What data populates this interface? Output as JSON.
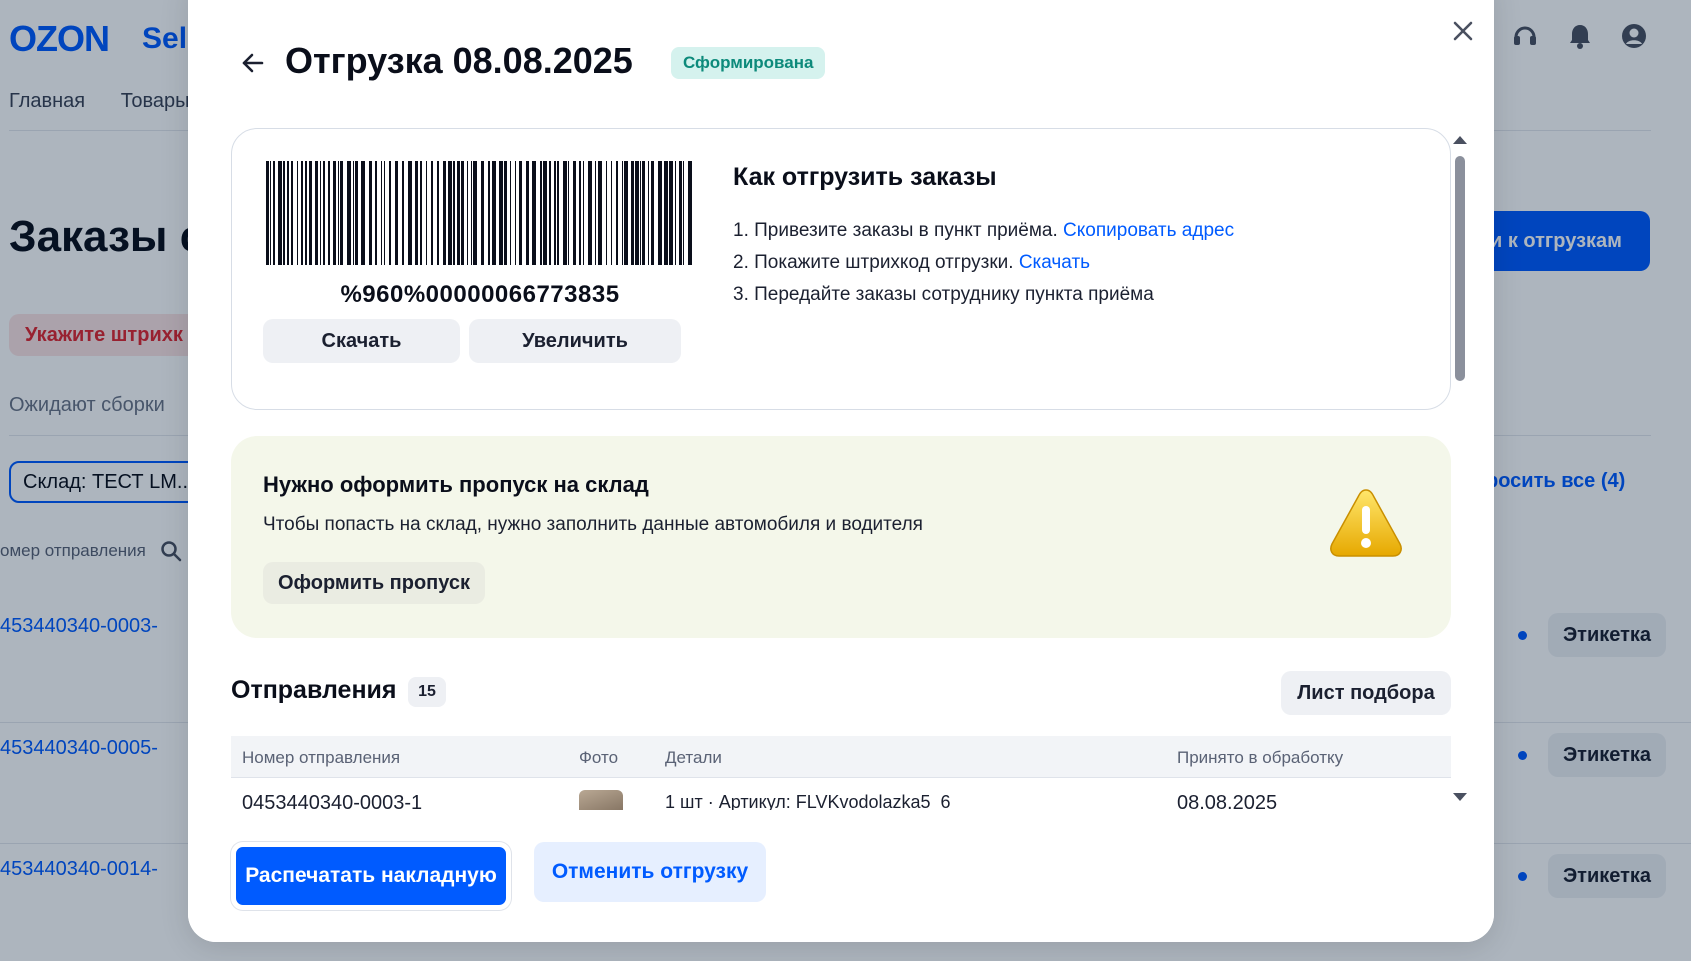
{
  "app": {
    "logo": "OZON",
    "logo_suffix": "Seller",
    "nav": [
      "Главная",
      "Товары"
    ]
  },
  "background": {
    "page_title": "Заказы c",
    "primary_button": "и к отгрузкам",
    "alert": "Укажите штрихк",
    "waiting_label": "Ожидают сборки",
    "warehouse_select": "Склад: ТЕСТ LM...",
    "reset_all": "росить все (4)",
    "column_label": "омер отправления",
    "orders": [
      {
        "number": "453440340-0003-",
        "label_button": "Этикетка"
      },
      {
        "number": "453440340-0005-",
        "label_button": "Этикетка"
      },
      {
        "number": "453440340-0014-",
        "label_button": "Этикетка"
      }
    ]
  },
  "modal": {
    "title": "Отгрузка 08.08.2025",
    "status": "Сформирована",
    "barcode": {
      "value": "%960%00000066773835",
      "download_label": "Скачать",
      "zoom_label": "Увеличить"
    },
    "how_to": {
      "title": "Как отгрузить заказы",
      "steps": [
        {
          "text": "1. Привезите заказы в пункт приёма.",
          "link": "Скопировать адрес"
        },
        {
          "text": "2. Покажите штрихкод отгрузки.",
          "link": "Скачать"
        },
        {
          "text": "3. Передайте заказы сотруднику пункта приёма",
          "link": ""
        }
      ]
    },
    "pass": {
      "title": "Нужно оформить пропуск на склад",
      "text": "Чтобы попасть на склад, нужно заполнить данные автомобиля и водителя",
      "button": "Оформить пропуск",
      "icon": "warning-icon"
    },
    "shipments": {
      "title": "Отправления",
      "count": "15",
      "pick_list_button": "Лист подбора",
      "columns": [
        "Номер отправления",
        "Фото",
        "Детали",
        "Принято в обработку"
      ],
      "rows": [
        {
          "number": "0453440340-0003-1",
          "details": "1 шт · Артикул: FLVKvodolazka5_6",
          "accepted": "08.08.2025"
        }
      ]
    },
    "footer": {
      "print_button": "Распечатать накладную",
      "cancel_button": "Отменить отгрузку"
    }
  },
  "colors": {
    "brand": "#005bff",
    "status_bg": "#d5f2ee",
    "status_text": "#0d8a7b",
    "alert_text": "#e0262e"
  }
}
